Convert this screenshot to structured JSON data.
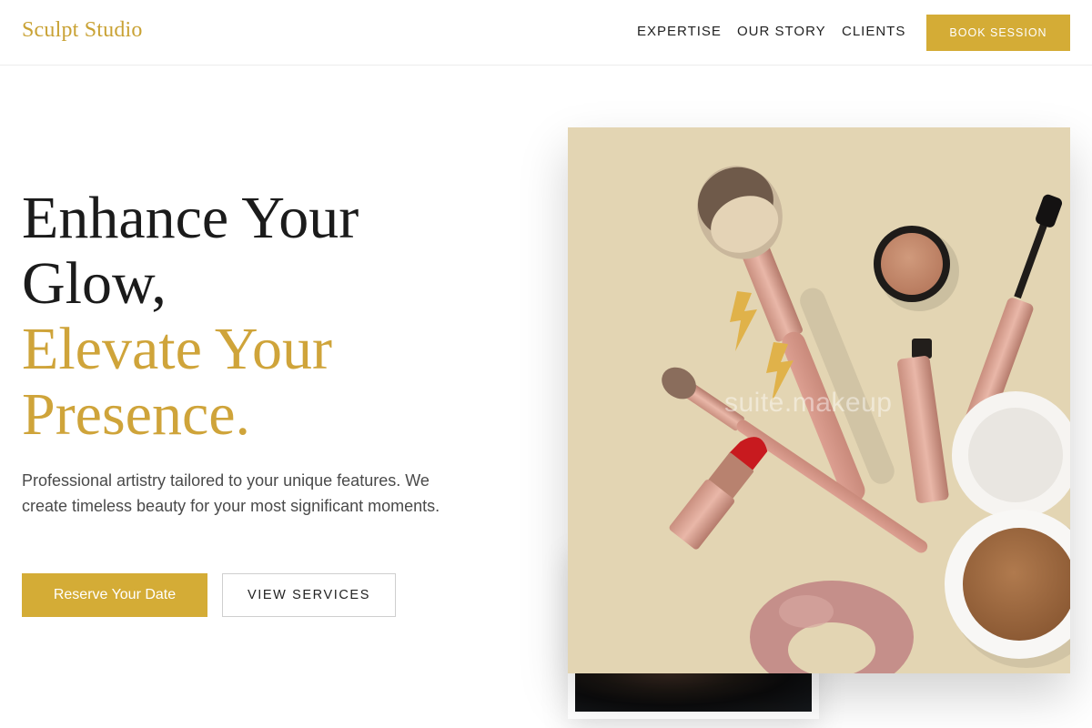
{
  "header": {
    "logo": "Sculpt Studio",
    "nav": [
      "EXPERTISE",
      "OUR STORY",
      "CLIENTS"
    ],
    "cta": "BOOK SESSION"
  },
  "hero": {
    "headline_dark": [
      "Enhance Your",
      "Glow,"
    ],
    "headline_gold": [
      "Elevate Your",
      "Presence."
    ],
    "description": "Professional artistry tailored to your unique features. We create timeless beauty for your most significant moments.",
    "primary_button": "Reserve Your Date",
    "secondary_button": "VIEW SERVICES",
    "image_watermark": "suite.makeup"
  },
  "colors": {
    "accent": "#d4ac36",
    "headline": "#1b1b1b",
    "gold_text": "#cfa43a",
    "image_background": "#e3d5b3"
  },
  "icons": [
    "makeup-flatlay-image"
  ]
}
